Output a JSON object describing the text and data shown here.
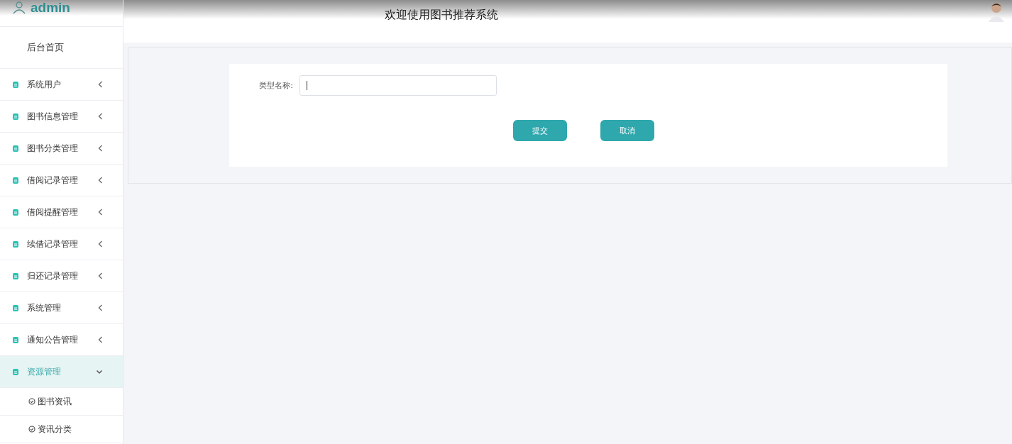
{
  "user": {
    "name": "admin"
  },
  "header": {
    "title": "欢迎使用图书推荐系统"
  },
  "menu": [
    {
      "kind": "link",
      "label": "后台首页",
      "selected": false
    },
    {
      "kind": "group",
      "label": "系统用户",
      "selected": false,
      "expanded": false
    },
    {
      "kind": "group",
      "label": "图书信息管理",
      "selected": false,
      "expanded": false
    },
    {
      "kind": "group",
      "label": "图书分类管理",
      "selected": false,
      "expanded": false
    },
    {
      "kind": "group",
      "label": "借阅记录管理",
      "selected": false,
      "expanded": false
    },
    {
      "kind": "group",
      "label": "借阅提醒管理",
      "selected": false,
      "expanded": false
    },
    {
      "kind": "group",
      "label": "续借记录管理",
      "selected": false,
      "expanded": false
    },
    {
      "kind": "group",
      "label": "归还记录管理",
      "selected": false,
      "expanded": false
    },
    {
      "kind": "group",
      "label": "系统管理",
      "selected": false,
      "expanded": false
    },
    {
      "kind": "group",
      "label": "通知公告管理",
      "selected": false,
      "expanded": false
    },
    {
      "kind": "group",
      "label": "资源管理",
      "selected": true,
      "expanded": true,
      "children": [
        {
          "label": "图书资讯"
        },
        {
          "label": "资讯分类"
        }
      ]
    }
  ],
  "form": {
    "fields": [
      {
        "label": "类型名称:"
      }
    ],
    "buttons": [
      "提交",
      "取消"
    ]
  }
}
